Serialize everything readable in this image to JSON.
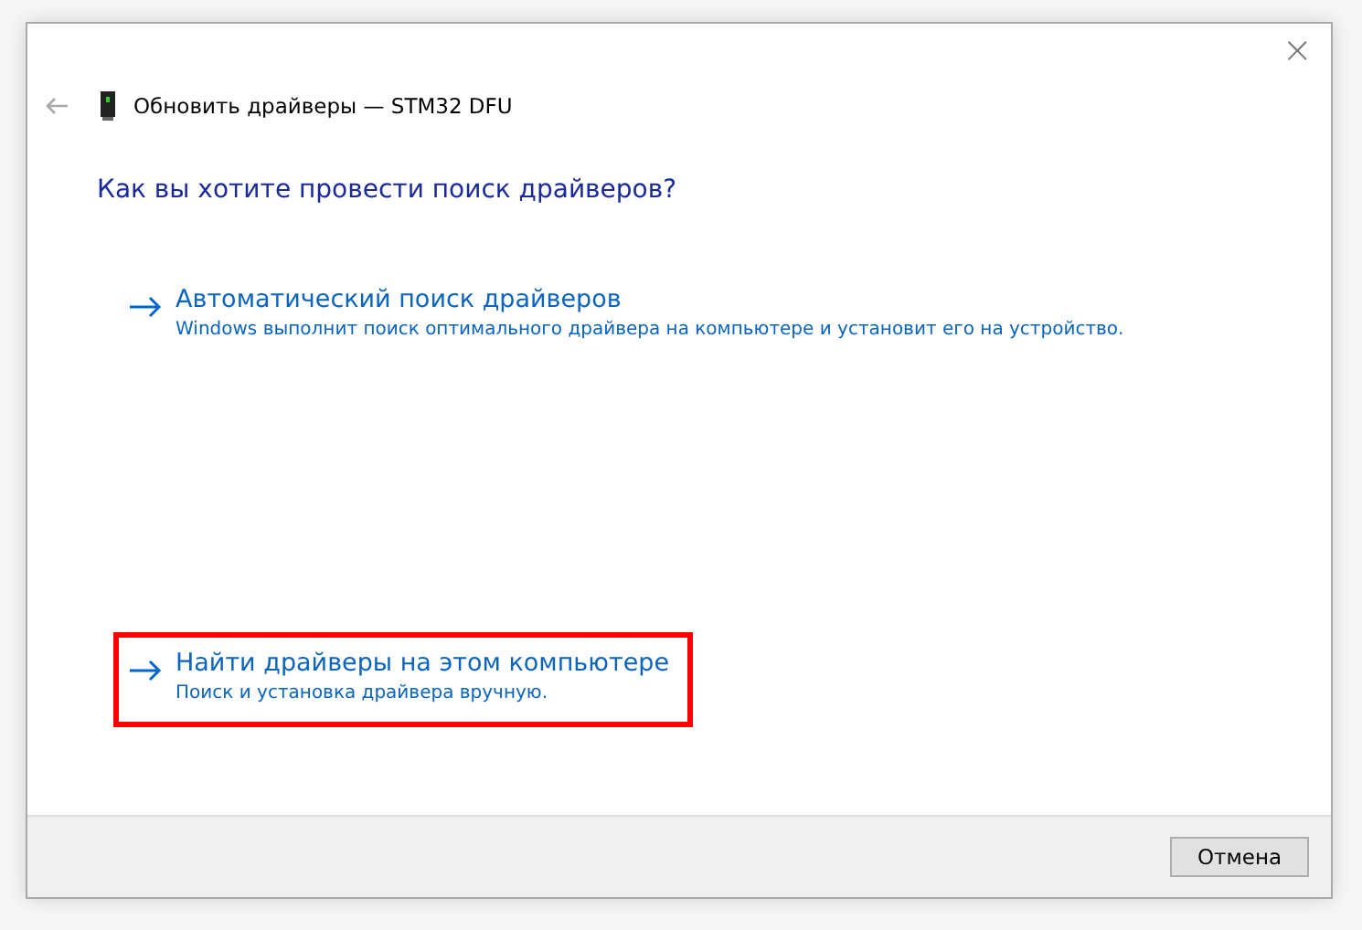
{
  "window": {
    "title": "Обновить драйверы — STM32 DFU",
    "close": "×"
  },
  "heading": "Как вы хотите провести поиск драйверов?",
  "options": [
    {
      "title": "Автоматический поиск драйверов",
      "description": "Windows выполнит поиск оптимального драйвера на компьютере и установит его на устройство.",
      "highlighted": false
    },
    {
      "title": "Найти драйверы на этом компьютере",
      "description": "Поиск и установка драйвера вручную.",
      "highlighted": true
    }
  ],
  "buttons": [
    "Отмена"
  ]
}
